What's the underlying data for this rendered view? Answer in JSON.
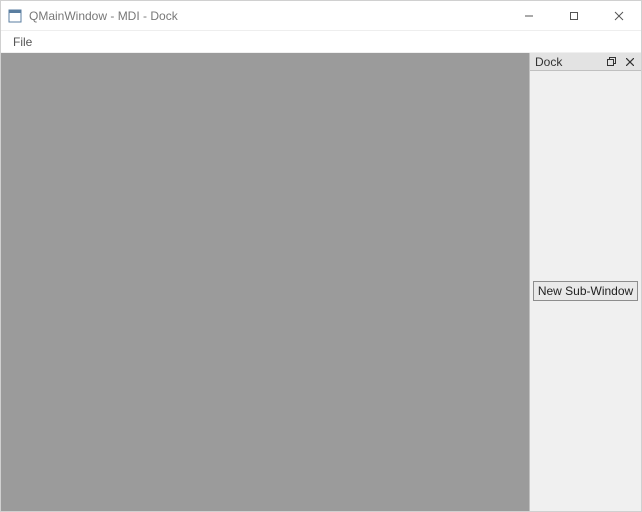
{
  "window": {
    "title": "QMainWindow - MDI - Dock"
  },
  "menubar": {
    "file_label": "File"
  },
  "dock": {
    "title": "Dock",
    "button_label": "New Sub-Window"
  }
}
